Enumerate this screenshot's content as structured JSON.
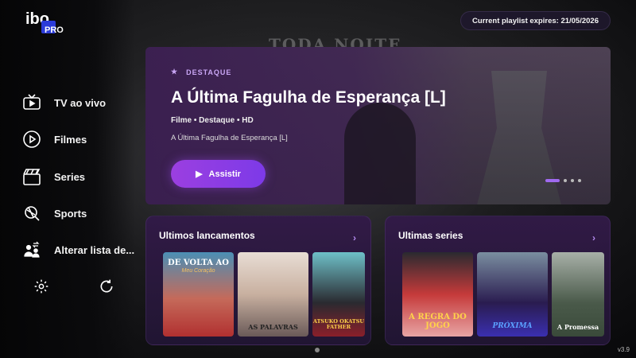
{
  "brand": {
    "logo_top": "ibo",
    "logo_bottom": "PRO"
  },
  "background_text": "TODA NOITE",
  "header": {
    "expiry_text": "Current playlist expires: 21/05/2026"
  },
  "sidebar": {
    "items": [
      {
        "label": "TV ao vivo",
        "icon": "tv-icon"
      },
      {
        "label": "Filmes",
        "icon": "play-circle-icon"
      },
      {
        "label": "Series",
        "icon": "clapperboard-icon"
      },
      {
        "label": "Sports",
        "icon": "sports-ball-icon"
      },
      {
        "label": "Alterar lista de...",
        "icon": "switch-users-icon"
      }
    ],
    "bottom": [
      {
        "icon": "gear-icon"
      },
      {
        "icon": "refresh-icon"
      }
    ]
  },
  "hero": {
    "badge": "DESTAQUE",
    "title": "A Última Fagulha de Esperança [L]",
    "meta": "Filme  •  Destaque  •  HD",
    "description": "A Última Fagulha de Esperança [L]",
    "play_label": "Assistir",
    "slides_total": 4,
    "slide_active": 1
  },
  "rows": [
    {
      "title": "Ultimos lancamentos",
      "posters": [
        {
          "top": "DE VOLTA AO",
          "sub": "Meu Coração",
          "caption": ""
        },
        {
          "top": "",
          "sub": "",
          "caption": "AS PALAVRAS"
        },
        {
          "top": "",
          "sub": "",
          "caption": "ATSUKO OKATSU FATHER"
        }
      ]
    },
    {
      "title": "Ultimas series",
      "posters": [
        {
          "top": "",
          "sub": "",
          "caption": "A REGRA DO JOGO"
        },
        {
          "top": "",
          "sub": "",
          "caption": "PRÓXIMA"
        },
        {
          "top": "",
          "sub": "",
          "caption": "A Promessa"
        }
      ]
    }
  ],
  "footer": {
    "version": "v3.9"
  },
  "colors": {
    "accent": "#9b3fe0",
    "badge": "#c9a6f5",
    "card_bg": "#321a48"
  }
}
